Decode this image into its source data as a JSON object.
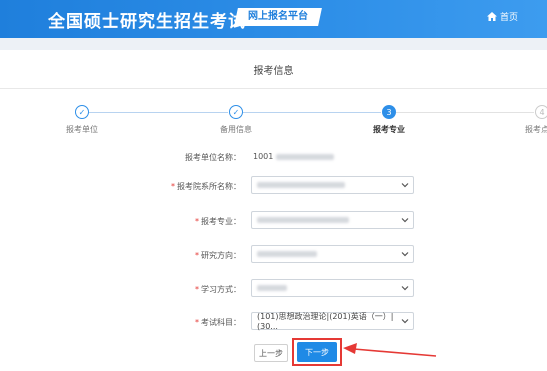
{
  "header": {
    "site_title": "全国硕士研究生招生考试",
    "platform_badge": "网上报名平台",
    "home_link": "首页"
  },
  "page": {
    "title": "报考信息"
  },
  "steps": [
    {
      "label": "报考单位",
      "state": "done",
      "marker": "✓"
    },
    {
      "label": "备用信息",
      "state": "done",
      "marker": "✓"
    },
    {
      "label": "报考专业",
      "state": "active",
      "marker": "3"
    },
    {
      "label": "报考点",
      "state": "todo",
      "marker": "4"
    }
  ],
  "form": {
    "unit_name": {
      "label": "报考单位名称：",
      "value_prefix": "1001"
    },
    "department": {
      "label": "报考院系所名称：",
      "required": "*"
    },
    "major": {
      "label": "报考专业：",
      "required": "*"
    },
    "research_direction": {
      "label": "研究方向：",
      "required": "*"
    },
    "study_mode": {
      "label": "学习方式：",
      "required": "*"
    },
    "exam_subjects": {
      "label": "考试科目：",
      "required": "*",
      "value": "(101)思想政治理论|(201)英语（一）|(30..."
    }
  },
  "actions": {
    "prev_label": "上一步",
    "next_label": "下一步"
  },
  "colors": {
    "header_blue": "#2e8fe8",
    "highlight_red": "#e53935"
  }
}
